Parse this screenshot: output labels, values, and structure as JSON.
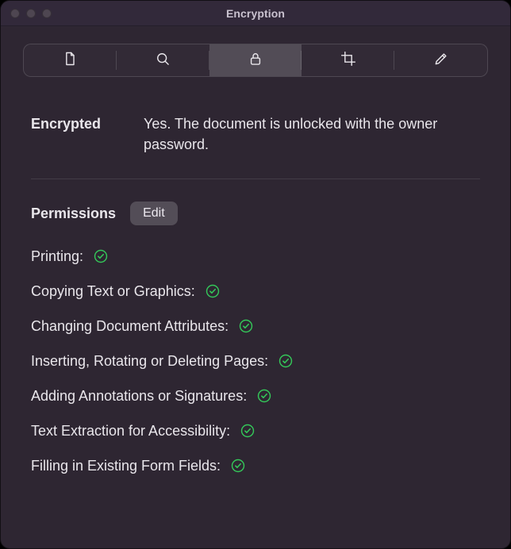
{
  "window": {
    "title": "Encryption"
  },
  "toolbar": {
    "tabs": [
      "document",
      "search",
      "encryption",
      "crop",
      "edit"
    ],
    "active_index": 2
  },
  "encrypted": {
    "label": "Encrypted",
    "value": "Yes. The document is unlocked with the owner password."
  },
  "permissions": {
    "label": "Permissions",
    "edit_button": "Edit",
    "items": [
      {
        "label": "Printing:",
        "allowed": true
      },
      {
        "label": "Copying Text or Graphics:",
        "allowed": true
      },
      {
        "label": "Changing Document Attributes:",
        "allowed": true
      },
      {
        "label": "Inserting, Rotating or Deleting Pages:",
        "allowed": true
      },
      {
        "label": "Adding Annotations or Signatures:",
        "allowed": true
      },
      {
        "label": "Text Extraction for Accessibility:",
        "allowed": true
      },
      {
        "label": "Filling in Existing Form Fields:",
        "allowed": true
      }
    ]
  },
  "colors": {
    "allowed": "#34c759"
  }
}
